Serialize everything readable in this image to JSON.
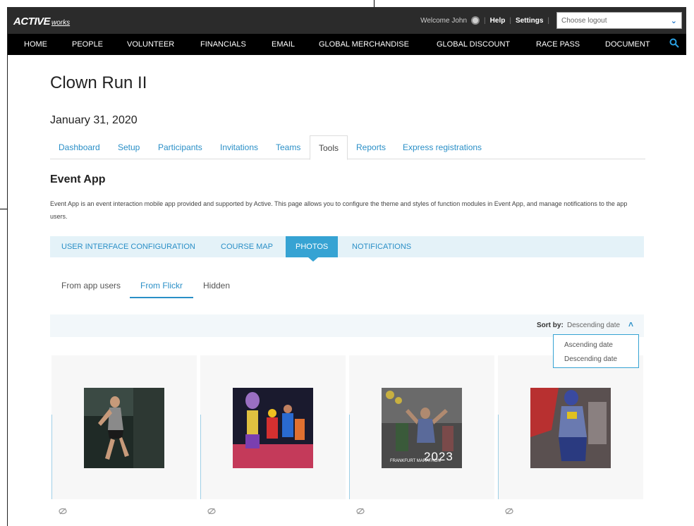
{
  "brand": {
    "logo_main": "ACTIVE",
    "logo_sub": "works"
  },
  "topbar": {
    "welcome": "Welcome John",
    "help": "Help",
    "settings": "Settings",
    "logout_placeholder": "Choose logout"
  },
  "nav": {
    "items": [
      "HOME",
      "PEOPLE",
      "VOLUNTEER",
      "FINANCIALS",
      "EMAIL",
      "GLOBAL MERCHANDISE",
      "GLOBAL DISCOUNT",
      "RACE PASS",
      "DOCUMENT"
    ]
  },
  "event": {
    "title": "Clown Run II",
    "date": "January 31, 2020"
  },
  "tabs": {
    "items": [
      "Dashboard",
      "Setup",
      "Participants",
      "Invitations",
      "Teams",
      "Tools",
      "Reports",
      "Express registrations"
    ],
    "active": "Tools"
  },
  "section": {
    "title": "Event App",
    "description": "Event App is an event interaction mobile app provided and supported by Active. This page allows you to configure the theme and styles of function modules in Event App, and manage notifications to the app users."
  },
  "subnav": {
    "items": [
      "USER INTERFACE CONFIGURATION",
      "COURSE MAP",
      "PHOTOS",
      "NOTIFICATIONS"
    ],
    "active": "PHOTOS"
  },
  "photo_tabs": {
    "items": [
      "From app users",
      "From Flickr",
      "Hidden"
    ],
    "active": "From Flickr"
  },
  "sort": {
    "label": "Sort by:",
    "value": "Descending date",
    "options": [
      "Ascending date",
      "Descending date"
    ]
  },
  "photos": [
    {
      "badge": ""
    },
    {
      "badge": ""
    },
    {
      "badge_small": "FRANKFURT MARATHON",
      "badge": "2023"
    },
    {
      "badge": ""
    }
  ],
  "colors": {
    "topbar": "#2b2b2b",
    "navbar": "#000000",
    "link": "#2a8fc7",
    "accent": "#36a3d3",
    "subnav_bg": "#e4f2f8"
  }
}
